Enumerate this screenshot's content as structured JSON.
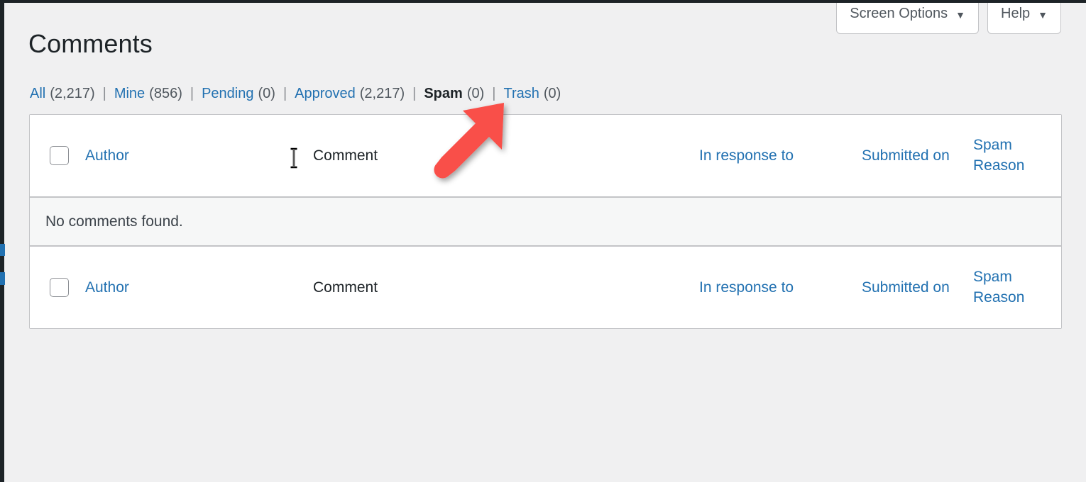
{
  "colors": {
    "accent_link": "#2271b1",
    "page_background": "#f0f0f1",
    "arrow": "#f9504a",
    "chrome_dark": "#1d2327",
    "border": "#c3c4c7",
    "no_items_background": "#f6f7f7"
  },
  "screen_meta": {
    "screen_options_label": "Screen Options",
    "help_label": "Help",
    "caret_glyph": "▼"
  },
  "header": {
    "title": "Comments"
  },
  "filters": {
    "separator": "|",
    "items": [
      {
        "label": "All",
        "count": "(2,217)",
        "current": false
      },
      {
        "label": "Mine",
        "count": "(856)",
        "current": false
      },
      {
        "label": "Pending",
        "count": "(0)",
        "current": false
      },
      {
        "label": "Approved",
        "count": "(2,217)",
        "current": false
      },
      {
        "label": "Spam",
        "count": "(0)",
        "current": true
      },
      {
        "label": "Trash",
        "count": "(0)",
        "current": false
      }
    ]
  },
  "table": {
    "columns": {
      "author": "Author",
      "comment": "Comment",
      "in_response_to": "In response to",
      "submitted_on": "Submitted on",
      "spam_reason_line1": "Spam",
      "spam_reason_line2": "Reason"
    },
    "empty_message": "No comments found.",
    "rows": []
  },
  "annotation": {
    "arrow_target": "Spam",
    "arrow_color": "#f9504a"
  }
}
